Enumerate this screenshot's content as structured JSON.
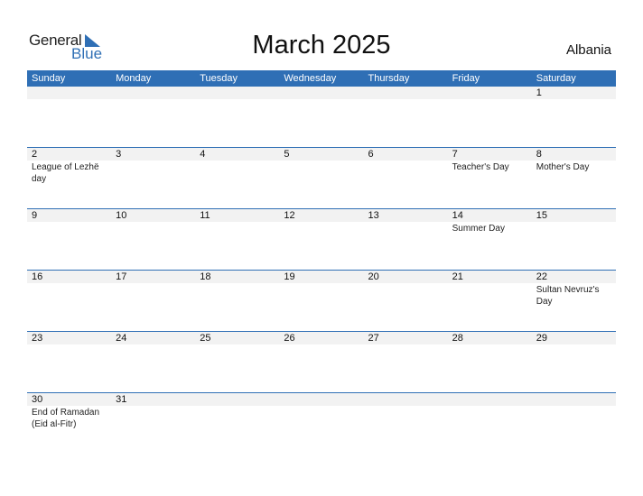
{
  "logo": {
    "general": "General",
    "blue": "Blue"
  },
  "title": "March 2025",
  "country": "Albania",
  "colors": {
    "accent": "#2f6fb5",
    "daybar": "#f2f2f2"
  },
  "weekdays": [
    "Sunday",
    "Monday",
    "Tuesday",
    "Wednesday",
    "Thursday",
    "Friday",
    "Saturday"
  ],
  "weeks": [
    [
      {
        "d": ""
      },
      {
        "d": ""
      },
      {
        "d": ""
      },
      {
        "d": ""
      },
      {
        "d": ""
      },
      {
        "d": ""
      },
      {
        "d": "1"
      }
    ],
    [
      {
        "d": "2",
        "h": "League of Lezhë day"
      },
      {
        "d": "3"
      },
      {
        "d": "4"
      },
      {
        "d": "5"
      },
      {
        "d": "6"
      },
      {
        "d": "7",
        "h": "Teacher's Day"
      },
      {
        "d": "8",
        "h": "Mother's Day"
      }
    ],
    [
      {
        "d": "9"
      },
      {
        "d": "10"
      },
      {
        "d": "11"
      },
      {
        "d": "12"
      },
      {
        "d": "13"
      },
      {
        "d": "14",
        "h": "Summer Day"
      },
      {
        "d": "15"
      }
    ],
    [
      {
        "d": "16"
      },
      {
        "d": "17"
      },
      {
        "d": "18"
      },
      {
        "d": "19"
      },
      {
        "d": "20"
      },
      {
        "d": "21"
      },
      {
        "d": "22",
        "h": "Sultan Nevruz's Day"
      }
    ],
    [
      {
        "d": "23"
      },
      {
        "d": "24"
      },
      {
        "d": "25"
      },
      {
        "d": "26"
      },
      {
        "d": "27"
      },
      {
        "d": "28"
      },
      {
        "d": "29"
      }
    ],
    [
      {
        "d": "30",
        "h": "End of Ramadan (Eid al-Fitr)"
      },
      {
        "d": "31"
      },
      {
        "d": ""
      },
      {
        "d": ""
      },
      {
        "d": ""
      },
      {
        "d": ""
      },
      {
        "d": ""
      }
    ]
  ]
}
